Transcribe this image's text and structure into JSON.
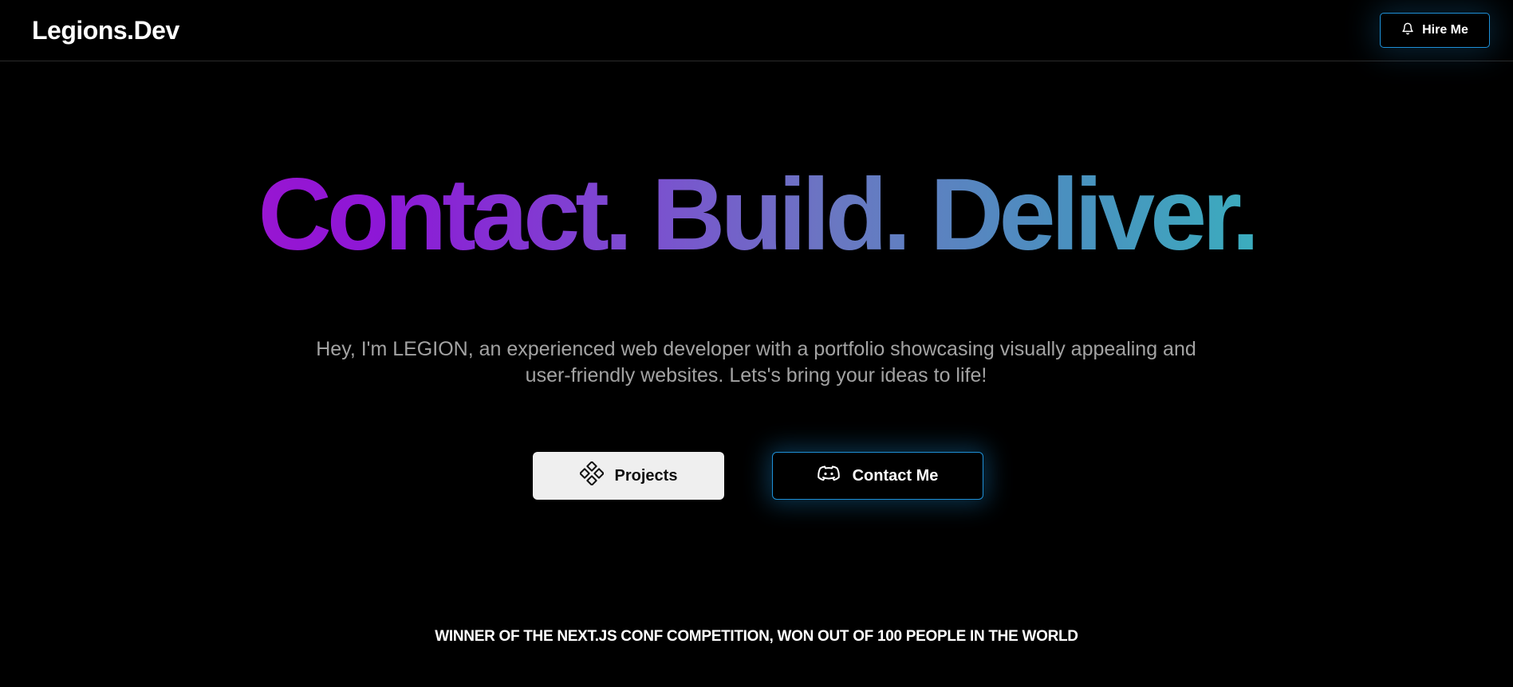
{
  "header": {
    "logo": "Legions.Dev",
    "hire_label": "Hire Me",
    "hire_icon": "bell-icon"
  },
  "hero": {
    "title": "Contact. Build. Deliver.",
    "subtitle_line1": "Hey, I'm LEGION, an experienced web developer with a portfolio showcasing visually appealing and",
    "subtitle_line2": "user-friendly websites. Lets's bring your ideas to life!",
    "gradient_colors": [
      "#b012c8",
      "#8d17d6",
      "#6a77c2",
      "#3aafbe",
      "#2ad4a8"
    ]
  },
  "actions": {
    "projects_label": "Projects",
    "projects_icon": "diamond-grid-icon",
    "contact_label": "Contact Me",
    "contact_icon": "discord-icon"
  },
  "footer": {
    "winner_text": "WINNER OF THE NEXT.JS CONF COMPETITION, WON OUT OF 100 PEOPLE IN THE WORLD"
  },
  "colors": {
    "background": "#000000",
    "accent": "#1e90d8",
    "subtitle": "#a3a3a3",
    "projects_bg": "#efefef"
  }
}
